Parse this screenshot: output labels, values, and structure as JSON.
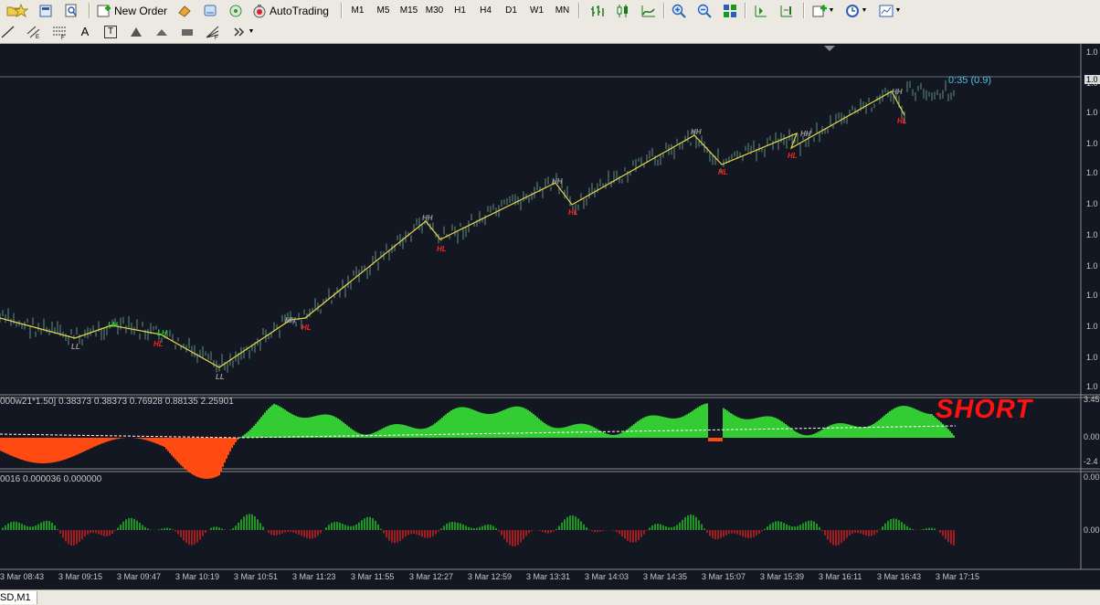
{
  "toolbar": {
    "new_order_label": "New Order",
    "auto_trading_label": "AutoTrading",
    "timeframes": [
      "M1",
      "M5",
      "M15",
      "M30",
      "H1",
      "H4",
      "D1",
      "W1",
      "MN"
    ],
    "icons_left": [
      "open-folder-icon",
      "favorites-icon",
      "profiles-icon",
      "zoom-window-icon"
    ],
    "icons_mid": [
      "new-order-icon",
      "market-watch-icon",
      "navigator-icon",
      "signal-icon",
      "auto-trading-icon"
    ],
    "icons_right": [
      "bar-chart-icon",
      "candle-chart-icon",
      "line-chart-icon",
      "zoom-in-icon",
      "zoom-out-icon",
      "tile-windows-icon",
      "scroll-chart-icon",
      "chart-shift-icon",
      "indicators-icon",
      "periods-icon",
      "templates-icon"
    ]
  },
  "drawing_toolbar": {
    "tools": [
      "line-tool-icon",
      "equidistant-channel-icon",
      "fibonacci-icon",
      "text-tool-icon",
      "text-label-icon",
      "arrow-icon",
      "rectangle-icon",
      "fibonacci-fan-icon",
      "more-tools-icon"
    ],
    "text_tool": "A",
    "text_label_tool": "T"
  },
  "main_chart": {
    "price_labels": [
      "1.0",
      "1.0",
      "1.0",
      "1.0",
      "1.0",
      "1.0",
      "1.0",
      "1.0",
      "1.0",
      "1.0",
      "1.0",
      "1.0"
    ],
    "current_price_tag": "1.0",
    "timer_text": "0:35 (0.9)",
    "swing_labels": [
      {
        "text": "LL",
        "color": "#9a9a9a"
      },
      {
        "text": "LH",
        "color": "#22cc22"
      },
      {
        "text": "LH",
        "color": "#22cc22"
      },
      {
        "text": "HL",
        "color": "#ff2020"
      },
      {
        "text": "LL",
        "color": "#9a9a9a"
      },
      {
        "text": "HH",
        "color": "#9a9a9a"
      },
      {
        "text": "HL",
        "color": "#ff2020"
      },
      {
        "text": "HH",
        "color": "#9a9a9a"
      },
      {
        "text": "HL",
        "color": "#ff2020"
      },
      {
        "text": "HH",
        "color": "#9a9a9a"
      },
      {
        "text": "HL",
        "color": "#ff2020"
      },
      {
        "text": "HH",
        "color": "#9a9a9a"
      },
      {
        "text": "HL",
        "color": "#ff2020"
      },
      {
        "text": "HH",
        "color": "#9a9a9a"
      },
      {
        "text": "HL",
        "color": "#ff2020"
      },
      {
        "text": "HH",
        "color": "#9a9a9a"
      },
      {
        "text": "HL",
        "color": "#ff2020"
      }
    ],
    "colors": {
      "background": "#131722",
      "candles": "#5f8f80",
      "zigzag": "#e8d84a",
      "grid": "#6b6b6b"
    }
  },
  "indicator1": {
    "label": "000w21*1.50] 0.38373 0.38373 0.76928 0.88135 2.25901",
    "scale_labels": [
      "3.45",
      "0.00",
      "-2.4"
    ],
    "signal_text": "SHORT",
    "colors": {
      "positive": "#33cc33",
      "negative": "#ff4a12",
      "baseline": "#ffffff",
      "signal": "#ff1111"
    }
  },
  "indicator2": {
    "label": "0016 0.000036 0.000000",
    "scale_labels": [
      "0.00",
      "0.00"
    ],
    "colors": {
      "positive": "#22cc22",
      "negative": "#dd2222"
    }
  },
  "time_axis": {
    "labels": [
      "3 Mar 08:43",
      "3 Mar 09:15",
      "3 Mar 09:47",
      "3 Mar 10:19",
      "3 Mar 10:51",
      "3 Mar 11:23",
      "3 Mar 11:55",
      "3 Mar 12:27",
      "3 Mar 12:59",
      "3 Mar 13:31",
      "3 Mar 14:03",
      "3 Mar 14:35",
      "3 Mar 15:07",
      "3 Mar 15:39",
      "3 Mar 16:11",
      "3 Mar 16:43",
      "3 Mar 17:15"
    ]
  },
  "status_bar": {
    "chart_tab": "SD,M1"
  }
}
